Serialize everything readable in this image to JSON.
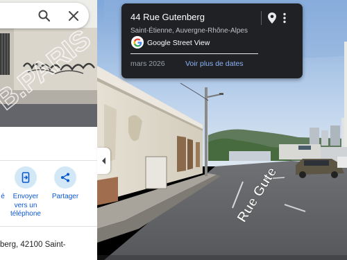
{
  "side_panel": {
    "watermark": "B.PARIS",
    "actions": [
      {
        "label": "é",
        "icon": "bookmark-icon"
      },
      {
        "label": "Envoyer vers un téléphone",
        "label_lines": [
          "Envoyer",
          "vers un",
          "téléphone"
        ],
        "icon": "send-to-phone-icon"
      },
      {
        "label": "Partager",
        "icon": "share-icon"
      }
    ],
    "address": "berg, 42100 Saint-"
  },
  "info_card": {
    "title": "44 Rue Gutenberg",
    "subtitle": "Saint-Étienne, Auvergne-Rhône-Alpes",
    "source": "Google Street View",
    "date": "mars 2026",
    "more_dates_link": "Voir plus de dates"
  },
  "street_label": "Rue Gutenberg",
  "street_label_visible": "Rue Gute",
  "colors": {
    "card_bg": "#202124",
    "link_blue": "#8ab4f8",
    "action_blue": "#0b57d0",
    "action_circle": "#d3e8f7"
  }
}
